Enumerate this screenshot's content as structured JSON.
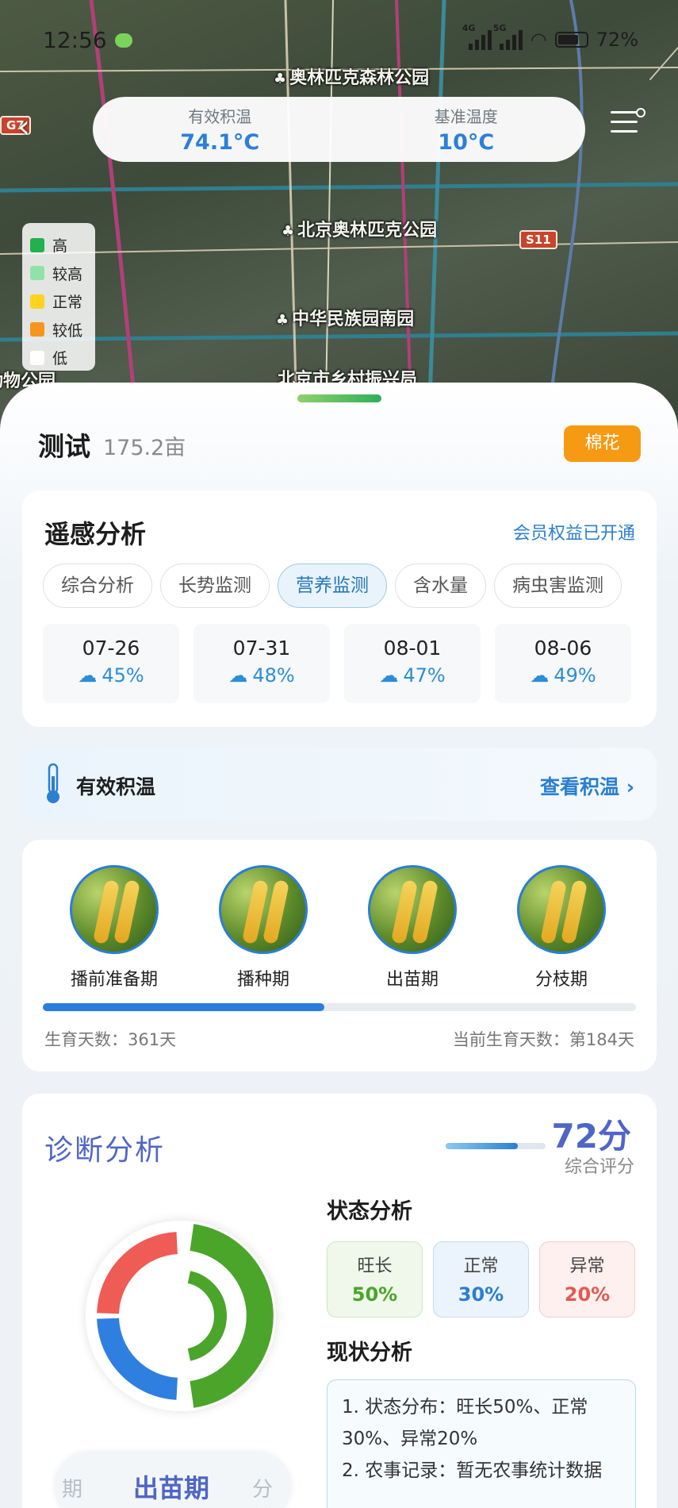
{
  "status_bar": {
    "time": "12:56",
    "battery": "72%",
    "net1": "4G",
    "net2": "5G"
  },
  "map": {
    "labels": [
      "奥林匹克森林公园",
      "北京奥林匹克公园",
      "中华民族园南园",
      "北京市乡村振兴局",
      "动物公园"
    ],
    "road_badges": [
      "G7",
      "S11"
    ]
  },
  "temp_summary": {
    "effective_label": "有效积温",
    "effective_value": "74.1°C",
    "base_label": "基准温度",
    "base_value": "10°C"
  },
  "legend": [
    {
      "label": "高",
      "color": "#22b14c"
    },
    {
      "label": "较高",
      "color": "#8fe3a8"
    },
    {
      "label": "正常",
      "color": "#ffd21f"
    },
    {
      "label": "较低",
      "color": "#f7941d"
    },
    {
      "label": "低",
      "color": "#ffffff"
    }
  ],
  "field": {
    "name": "测试",
    "area": "175.2亩",
    "crop": "棉花"
  },
  "remote_sensing": {
    "title": "遥感分析",
    "member_link": "会员权益已开通",
    "tabs": [
      "综合分析",
      "长势监测",
      "营养监测",
      "含水量",
      "病虫害监测"
    ],
    "active_tab": "营养监测",
    "dates": [
      {
        "date": "07-26",
        "cloud": "45%"
      },
      {
        "date": "07-31",
        "cloud": "48%"
      },
      {
        "date": "08-01",
        "cloud": "47%"
      },
      {
        "date": "08-06",
        "cloud": "49%"
      }
    ]
  },
  "effective_temp": {
    "label": "有效积温",
    "link": "查看积温 ›"
  },
  "growth": {
    "stages": [
      "播前准备期",
      "播种期",
      "出苗期",
      "分枝期"
    ],
    "progress_fraction": 0.475,
    "total_days": "生育天数：361天",
    "current_days": "当前生育天数：第184天"
  },
  "diagnosis": {
    "title": "诊断分析",
    "score": "72分",
    "score_label": "综合评分",
    "score_fraction": 0.72,
    "status_title": "状态分析",
    "status": [
      {
        "label": "旺长",
        "value": "50%"
      },
      {
        "label": "正常",
        "value": "30%"
      },
      {
        "label": "异常",
        "value": "20%"
      }
    ],
    "current_title": "现状分析",
    "current_lines": [
      "1. 状态分布：旺长50%、正常30%、异常20%",
      "2. 农事记录：暂无农事统计数据"
    ],
    "stage_prev": "期",
    "stage_current": "出苗期",
    "stage_next": "分枝",
    "colors": {
      "vigorous": "#4aa52a",
      "normal": "#2f7fe0",
      "abnormal": "#ef5b55"
    }
  }
}
